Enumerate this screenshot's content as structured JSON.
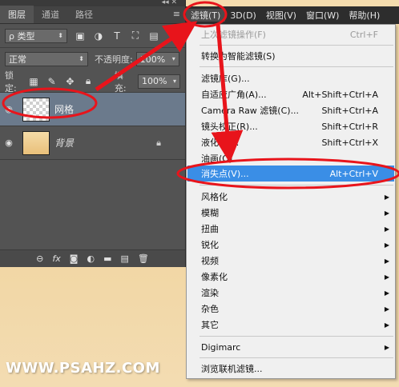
{
  "panel": {
    "tabs": [
      {
        "label": "图层"
      },
      {
        "label": "通道"
      },
      {
        "label": "路径"
      }
    ],
    "filter": {
      "kind": "ρ 类型"
    },
    "blend_mode": "正常",
    "opacity_label": "不透明度:",
    "opacity_value": "100%",
    "lock_label": "锁定:",
    "fill_label": "填充:",
    "fill_value": "100%",
    "layers": [
      {
        "name": "网格",
        "selected": true
      },
      {
        "name": "背景",
        "selected": false
      }
    ],
    "footer_icons": [
      "link-icon",
      "fx-icon",
      "mask-icon",
      "adjustment-icon",
      "group-icon",
      "new-layer-icon",
      "trash-icon"
    ]
  },
  "menubar": {
    "items": [
      {
        "label": "滤镜(T)",
        "active": true
      },
      {
        "label": "3D(D)"
      },
      {
        "label": "视图(V)"
      },
      {
        "label": "窗口(W)"
      },
      {
        "label": "帮助(H)"
      }
    ]
  },
  "filter_menu": {
    "items": [
      {
        "label": "上次滤镜操作(F)",
        "shortcut": "Ctrl+F",
        "disabled": true
      },
      {
        "label": "转换为智能滤镜(S)"
      },
      {
        "label": "滤镜库(G)..."
      },
      {
        "label": "自适应广角(A)...",
        "shortcut": "Alt+Shift+Ctrl+A"
      },
      {
        "label": "Camera Raw 滤镜(C)...",
        "shortcut": "Shift+Ctrl+A"
      },
      {
        "label": "镜头校正(R)...",
        "shortcut": "Shift+Ctrl+R"
      },
      {
        "label": "液化(L)...",
        "shortcut": "Shift+Ctrl+X"
      },
      {
        "label": "油画(O)..."
      },
      {
        "label": "消失点(V)...",
        "shortcut": "Alt+Ctrl+V",
        "highlighted": true
      },
      {
        "label": "风格化",
        "submenu": true
      },
      {
        "label": "模糊",
        "submenu": true
      },
      {
        "label": "扭曲",
        "submenu": true
      },
      {
        "label": "锐化",
        "submenu": true
      },
      {
        "label": "视频",
        "submenu": true
      },
      {
        "label": "像素化",
        "submenu": true
      },
      {
        "label": "渲染",
        "submenu": true
      },
      {
        "label": "杂色",
        "submenu": true
      },
      {
        "label": "其它",
        "submenu": true
      },
      {
        "label": "Digimarc",
        "submenu": true
      },
      {
        "label": "浏览联机滤镜..."
      }
    ]
  },
  "watermark": "WWW.PSAHZ.COM",
  "annotation_color": "#e8141b",
  "highlight_color": "#3a8ee6"
}
